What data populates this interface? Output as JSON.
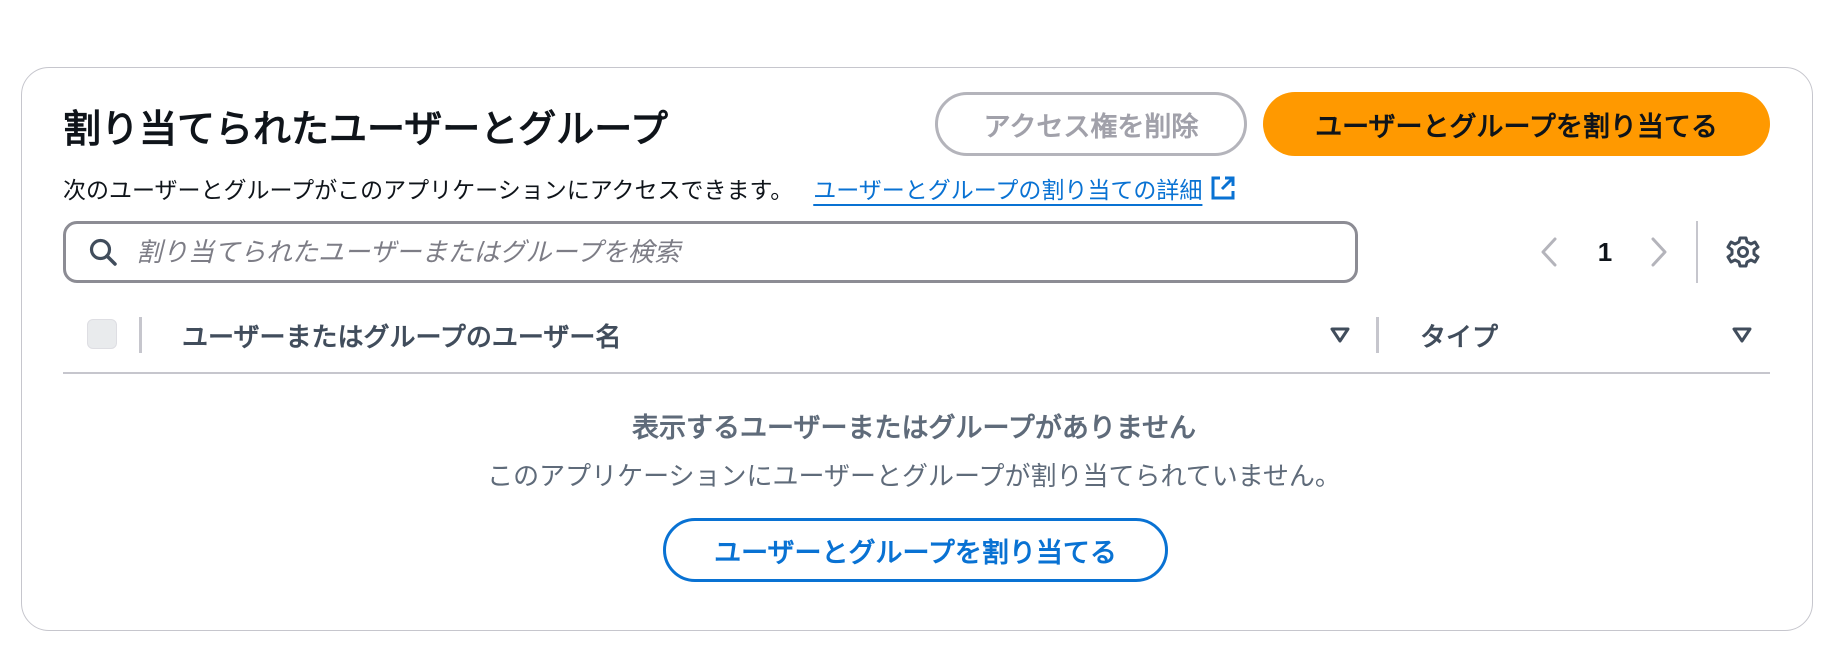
{
  "header": {
    "title": "割り当てられたユーザーとグループ",
    "remove_access_label": "アクセス権を削除",
    "assign_label": "ユーザーとグループを割り当てる",
    "description": "次のユーザーとグループがこのアプリケーションにアクセスできます。",
    "details_link": "ユーザーとグループの割り当ての詳細"
  },
  "search": {
    "placeholder": "割り当てられたユーザーまたはグループを検索",
    "value": ""
  },
  "pagination": {
    "current_page": "1"
  },
  "table": {
    "columns": [
      {
        "label": "ユーザーまたはグループのユーザー名"
      },
      {
        "label": "タイプ"
      }
    ],
    "rows": []
  },
  "empty_state": {
    "title": "表示するユーザーまたはグループがありません",
    "description": "このアプリケーションにユーザーとグループが割り当てられていません。",
    "assign_label": "ユーザーとグループを割り当てる"
  },
  "colors": {
    "primary_button": "#ff9900",
    "link": "#0972d3",
    "border": "#c6c6cd",
    "muted_text": "#5f6b7a"
  }
}
